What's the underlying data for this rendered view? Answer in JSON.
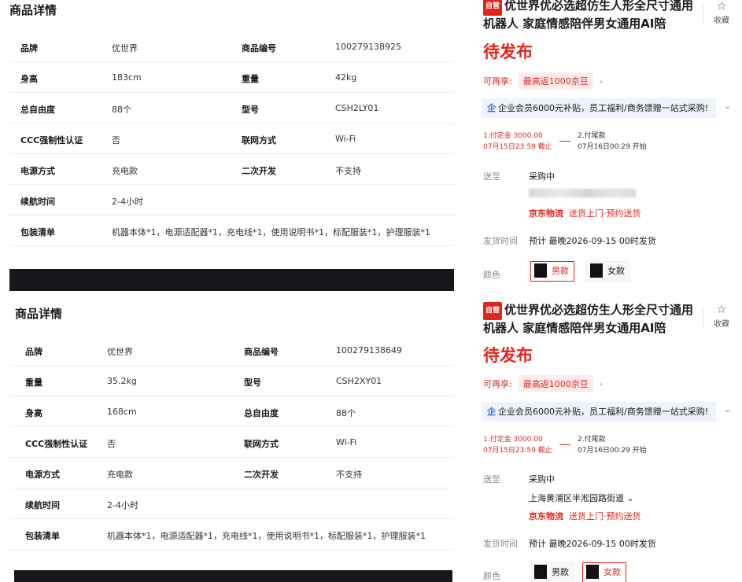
{
  "panels": [
    {
      "spec": {
        "title": "商品详情",
        "rows": [
          {
            "l1": "品牌",
            "v1": "优世界",
            "l2": "商品编号",
            "v2": "100279138925"
          },
          {
            "l1": "身高",
            "v1": "183cm",
            "l2": "重量",
            "v2": "42kg"
          },
          {
            "l1": "总自由度",
            "v1": "88个",
            "l2": "型号",
            "v2": "CSH2LY01"
          },
          {
            "l1": "CCC强制性认证",
            "v1": "否",
            "l2": "联网方式",
            "v2": "Wi-Fi"
          },
          {
            "l1": "电源方式",
            "v1": "充电款",
            "l2": "二次开发",
            "v2": "不支持"
          },
          {
            "l1": "续航时间",
            "v1": "2-4小时",
            "l2": "",
            "v2": ""
          },
          {
            "l1": "包装清单",
            "v1": "机器本体*1，电源适配器*1，充电线*1，使用说明书*1，标配服装*1，护理服装*1",
            "l2": "",
            "v2": ""
          }
        ]
      },
      "product": {
        "badge": "自营",
        "title": "优世界优必选超仿生人形全尺寸通用机器人 家庭情感陪伴男女通用AI陪",
        "fav_label": "收藏",
        "status": "待发布",
        "promo_prefix": "可再享:",
        "promo_chip": "最高返1000京豆",
        "promo_arrow": "›",
        "enterprise_icon": "企",
        "enterprise_text": "企业会员6000元补贴，员工福利/商务馈赠一站式采购!",
        "enterprise_chevron": "⌄",
        "step1_line1": "1.付定金 3000.00",
        "step1_line2": "07月15日23:59 截止",
        "step2_line1": "2.付尾款",
        "step2_line2": "07月16日00:29 开始",
        "ship_to_label": "送至",
        "ship_status": "采购中",
        "address": "",
        "logistics_brand": "京东物流",
        "logistics_service": "送货上门·预约送货",
        "delivery_label": "发货时间",
        "delivery_value": "预计 最晚2026-09-15 00时发货",
        "color_label": "颜色",
        "options": [
          {
            "label": "男款",
            "selected": true
          },
          {
            "label": "女款",
            "selected": false
          }
        ]
      }
    },
    {
      "spec": {
        "title": "商品详情",
        "rows": [
          {
            "l1": "品牌",
            "v1": "优世界",
            "l2": "商品编号",
            "v2": "100279138649"
          },
          {
            "l1": "重量",
            "v1": "35.2kg",
            "l2": "型号",
            "v2": "CSH2XY01"
          },
          {
            "l1": "身高",
            "v1": "168cm",
            "l2": "总自由度",
            "v2": "88个"
          },
          {
            "l1": "CCC强制性认证",
            "v1": "否",
            "l2": "联网方式",
            "v2": "Wi-Fi"
          },
          {
            "l1": "电源方式",
            "v1": "充电款",
            "l2": "二次开发",
            "v2": "不支持"
          },
          {
            "l1": "续航时间",
            "v1": "2-4小时",
            "l2": "",
            "v2": ""
          },
          {
            "l1": "包装清单",
            "v1": "机器本体*1，电源适配器*1，充电线*1，使用说明书*1，标配服装*1，护理服装*1",
            "l2": "",
            "v2": ""
          }
        ]
      },
      "product": {
        "badge": "自营",
        "title": "优世界优必选超仿生人形全尺寸通用机器人 家庭情感陪伴男女通用AI陪",
        "fav_label": "收藏",
        "status": "待发布",
        "promo_prefix": "可再享:",
        "promo_chip": "最高返1000京豆",
        "promo_arrow": "›",
        "enterprise_icon": "企",
        "enterprise_text": "企业会员6000元补贴，员工福利/商务馈赠一站式采购!",
        "enterprise_chevron": "⌄",
        "step1_line1": "1.付定金 3000.00",
        "step1_line2": "07月15日23:59 截止",
        "step2_line1": "2.付尾款",
        "step2_line2": "07月16日00:29 开始",
        "ship_to_label": "送至",
        "ship_status": "采购中",
        "address": "上海黄浦区半淞园路街道 ⌄",
        "logistics_brand": "京东物流",
        "logistics_service": "送货上门·预约送货",
        "delivery_label": "发货时间",
        "delivery_value": "预计 最晚2026-09-15 00时发货",
        "color_label": "颜色",
        "options": [
          {
            "label": "男款",
            "selected": false
          },
          {
            "label": "女款",
            "selected": true
          }
        ]
      }
    }
  ],
  "colors": {
    "accent": "#e1251b",
    "enterprise_bg": "#eef2fb",
    "dark_bar": "#16181b"
  },
  "icons": {
    "favorite": "star-outline-icon",
    "enterprise": "enterprise-badge-icon"
  }
}
